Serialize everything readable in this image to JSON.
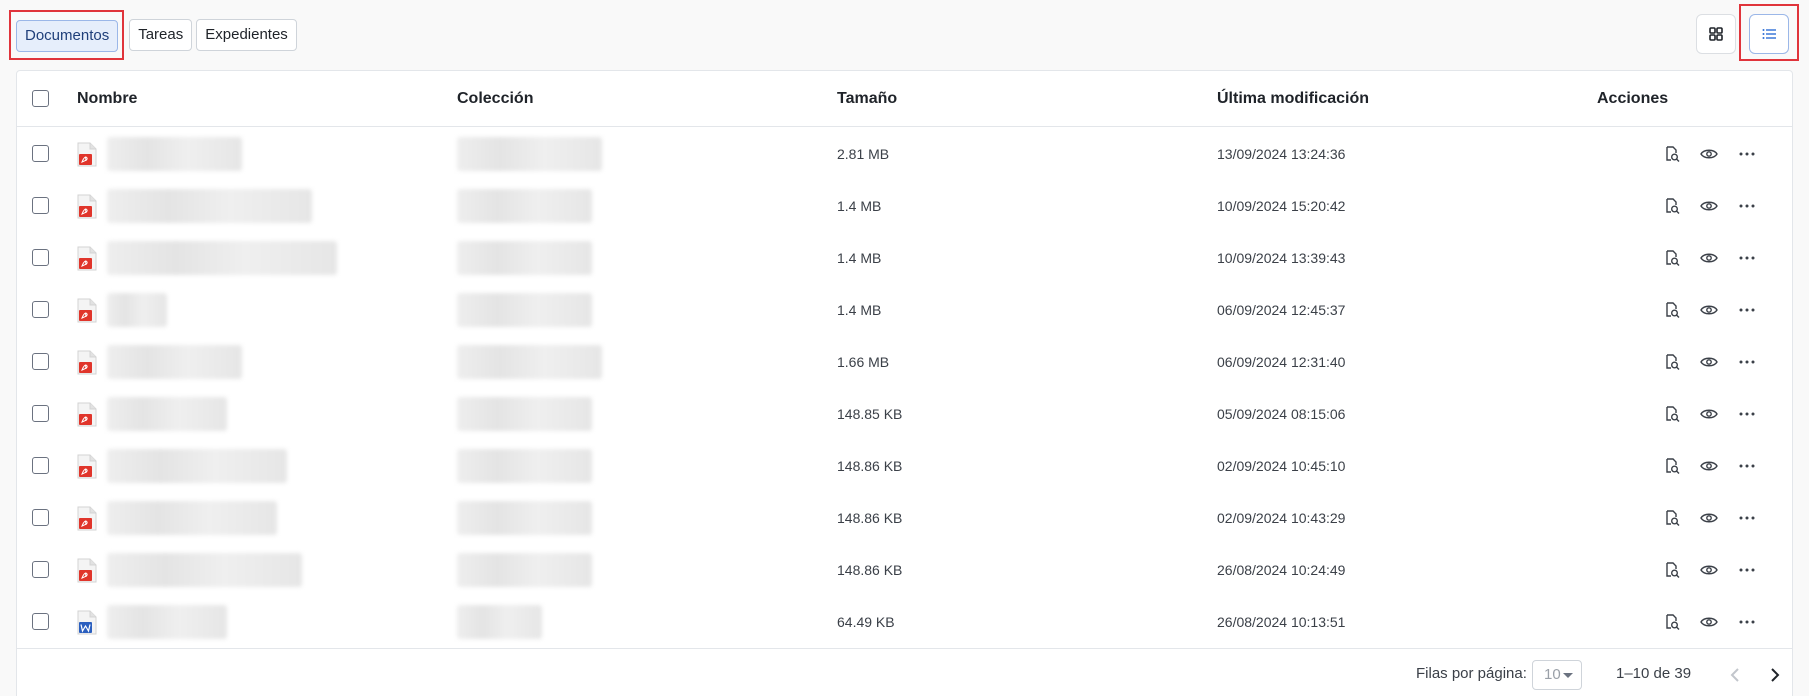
{
  "tabs": [
    {
      "label": "Documentos",
      "active": true
    },
    {
      "label": "Tareas",
      "active": false
    },
    {
      "label": "Expedientes",
      "active": false
    }
  ],
  "view_toggle": {
    "grid_icon": "grid-icon",
    "list_icon": "list-icon",
    "selected": "list"
  },
  "table": {
    "headers": {
      "name": "Nombre",
      "collection": "Colección",
      "size": "Tamaño",
      "modified": "Última modificación",
      "actions": "Acciones"
    },
    "rows": [
      {
        "type": "pdf",
        "size": "2.81 MB",
        "modified": "13/09/2024 13:24:36"
      },
      {
        "type": "pdf",
        "size": "1.4 MB",
        "modified": "10/09/2024 15:20:42"
      },
      {
        "type": "pdf",
        "size": "1.4 MB",
        "modified": "10/09/2024 13:39:43"
      },
      {
        "type": "pdf",
        "size": "1.4 MB",
        "modified": "06/09/2024 12:45:37"
      },
      {
        "type": "pdf",
        "size": "1.66 MB",
        "modified": "06/09/2024 12:31:40"
      },
      {
        "type": "pdf",
        "size": "148.85 KB",
        "modified": "05/09/2024 08:15:06"
      },
      {
        "type": "pdf",
        "size": "148.86 KB",
        "modified": "02/09/2024 10:45:10"
      },
      {
        "type": "pdf",
        "size": "148.86 KB",
        "modified": "02/09/2024 10:43:29"
      },
      {
        "type": "pdf",
        "size": "148.86 KB",
        "modified": "26/08/2024 10:24:49"
      },
      {
        "type": "word",
        "size": "64.49 KB",
        "modified": "26/08/2024 10:13:51"
      }
    ],
    "row_actions": [
      "document-search-icon",
      "eye-icon",
      "more-horizontal-icon"
    ]
  },
  "pagination": {
    "rows_per_page_label": "Filas por página:",
    "rows_per_page_value": "10",
    "range_text": "1–10 de 39"
  },
  "colors": {
    "accent": "#2f6fd6",
    "highlight": "#e0343b",
    "pdf": "#e0352b",
    "word": "#2b5fbf"
  }
}
